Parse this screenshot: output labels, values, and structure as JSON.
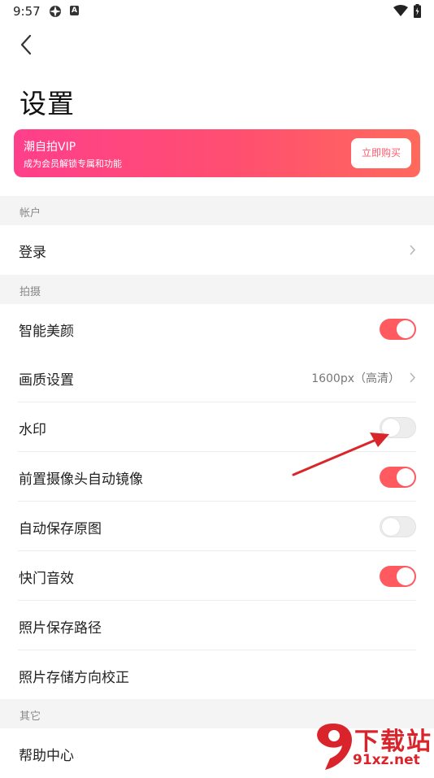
{
  "status_bar": {
    "time": "9:57",
    "notif_icon_letter": "A"
  },
  "page": {
    "title": "设置"
  },
  "vip": {
    "title": "潮自拍VIP",
    "subtitle": "成为会员解锁专属和功能",
    "buy_label": "立即购买"
  },
  "sections": {
    "account": "帐户",
    "shooting": "拍摄",
    "other": "其它"
  },
  "rows": {
    "login": "登录",
    "smart_beauty": "智能美颜",
    "quality": "画质设置",
    "quality_value": "1600px（高清）",
    "watermark": "水印",
    "mirror": "前置摄像头自动镜像",
    "save_original": "自动保存原图",
    "shutter_sound": "快门音效",
    "save_path": "照片保存路径",
    "orientation": "照片存储方向校正",
    "help": "帮助中心"
  },
  "toggles": {
    "smart_beauty": true,
    "watermark": false,
    "mirror": true,
    "save_original": false,
    "shutter_sound": true
  },
  "colors": {
    "accent": "#ff5a60",
    "vip_start": "#ff3f8b",
    "vip_end": "#ff6a5c",
    "annotation": "#d8262a"
  },
  "site_watermark": {
    "text": "下载站",
    "domain": "91xz.net",
    "logo_text": "9"
  }
}
